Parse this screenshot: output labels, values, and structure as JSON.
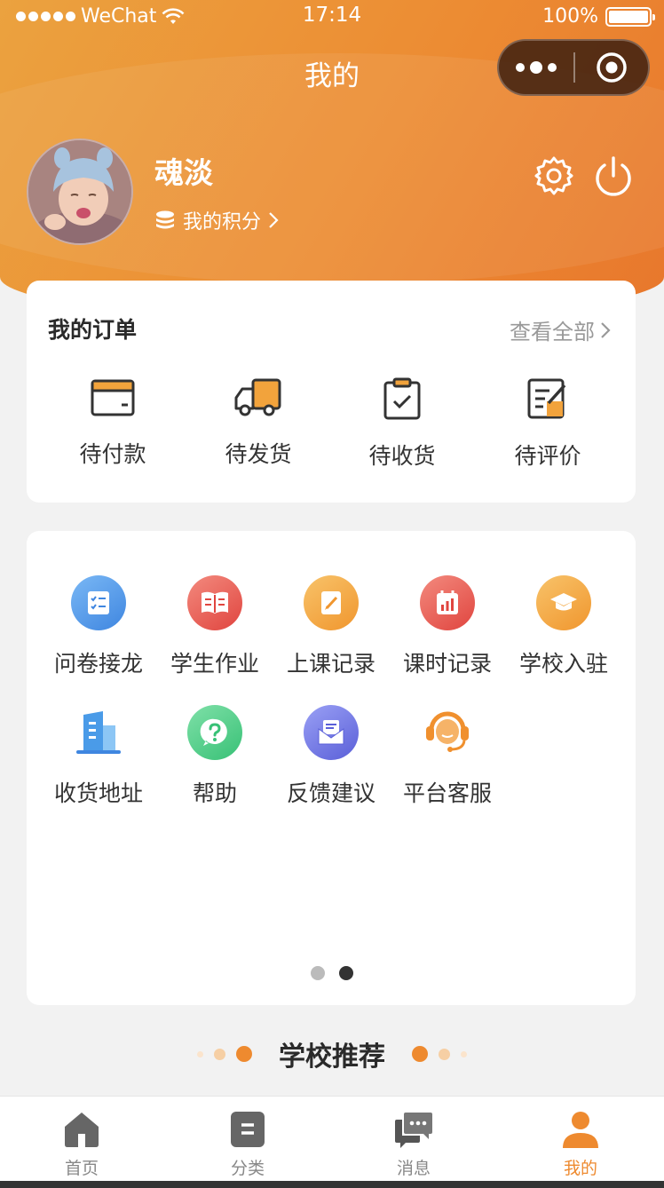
{
  "status_bar": {
    "carrier": "WeChat",
    "time": "17:14",
    "battery": "100%"
  },
  "nav": {
    "title": "我的"
  },
  "profile": {
    "name": "魂淡",
    "points_label": "我的积分"
  },
  "orders": {
    "title": "我的订单",
    "view_all": "查看全部",
    "items": [
      {
        "label": "待付款",
        "icon": "wallet-icon"
      },
      {
        "label": "待发货",
        "icon": "truck-icon"
      },
      {
        "label": "待收货",
        "icon": "clipboard-check-icon"
      },
      {
        "label": "待评价",
        "icon": "edit-note-icon"
      }
    ]
  },
  "services": {
    "items": [
      {
        "label": "问卷接龙",
        "icon": "checklist-icon",
        "color": "#4a90e2"
      },
      {
        "label": "学生作业",
        "icon": "book-icon",
        "color": "#e8534d"
      },
      {
        "label": "上课记录",
        "icon": "notebook-pen-icon",
        "color": "#f2a33c"
      },
      {
        "label": "课时记录",
        "icon": "calendar-chart-icon",
        "color": "#e8534d"
      },
      {
        "label": "学校入驻",
        "icon": "graduation-cap-icon",
        "color": "#f2a33c"
      },
      {
        "label": "收货地址",
        "icon": "building-icon",
        "color": "#4a90e2"
      },
      {
        "label": "帮助",
        "icon": "question-icon",
        "color": "#3dc47e"
      },
      {
        "label": "反馈建议",
        "icon": "envelope-icon",
        "color": "#6a6ee0"
      },
      {
        "label": "平台客服",
        "icon": "headset-icon",
        "color": "#f0902e"
      }
    ],
    "page_count": 2,
    "current_page": 2
  },
  "recommend": {
    "title": "学校推荐"
  },
  "tabbar": {
    "items": [
      {
        "label": "首页",
        "icon": "home-icon"
      },
      {
        "label": "分类",
        "icon": "category-icon"
      },
      {
        "label": "消息",
        "icon": "chat-icon"
      },
      {
        "label": "我的",
        "icon": "person-icon",
        "active": true
      }
    ]
  },
  "colors": {
    "accent": "#ee8a2f",
    "header_start": "#eba23f",
    "header_end": "#e8772c"
  }
}
